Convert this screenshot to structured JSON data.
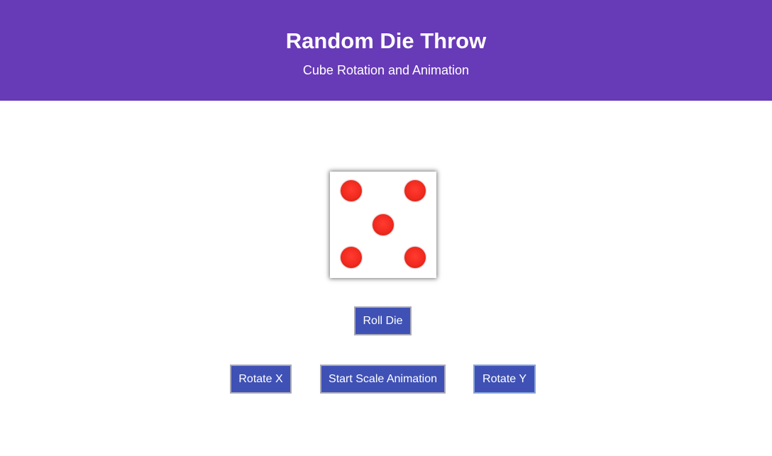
{
  "header": {
    "title": "Random Die Throw",
    "subtitle": "Cube Rotation and Animation",
    "background_color": "#673ab7"
  },
  "die": {
    "face_value": 5,
    "pip_color": "#f22a1f"
  },
  "controls": {
    "roll_label": "Roll Die",
    "rotate_x_label": "Rotate X",
    "scale_label": "Start Scale Animation",
    "rotate_y_label": "Rotate Y",
    "button_color": "#3f51b5"
  }
}
